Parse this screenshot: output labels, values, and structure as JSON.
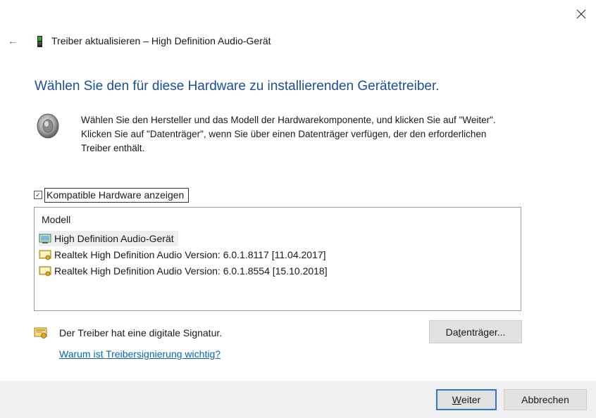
{
  "window": {
    "close_glyph": "✕",
    "back_glyph": "←",
    "title": "Treiber aktualisieren – High Definition Audio-Gerät"
  },
  "heading": "Wählen Sie den für diese Hardware zu installierenden Gerätetreiber.",
  "description": "Wählen Sie den Hersteller und das Modell der Hardwarekomponente, und klicken Sie auf \"Weiter\". Klicken Sie auf \"Datenträger\", wenn Sie über einen Datenträger verfügen, der den erforderlichen Treiber enthält.",
  "compatible": {
    "label": "Kompatible Hardware anzeigen",
    "checked": true,
    "check_glyph": "✓"
  },
  "list": {
    "header": "Modell",
    "items": [
      {
        "label": "High Definition Audio-Gerät",
        "icon": "audio-device-icon",
        "selected": true
      },
      {
        "label": "Realtek High Definition Audio Version: 6.0.1.8117 [11.04.2017]",
        "icon": "certified-driver-icon",
        "selected": false
      },
      {
        "label": "Realtek High Definition Audio Version: 6.0.1.8554 [15.10.2018]",
        "icon": "certified-driver-icon",
        "selected": false
      }
    ]
  },
  "signature": {
    "text": "Der Treiber hat eine digitale Signatur.",
    "link": "Warum ist Treibersignierung wichtig?",
    "icon": "certificate-icon"
  },
  "buttons": {
    "disk": {
      "pre": "Da",
      "access": "t",
      "post": "enträger..."
    },
    "next": {
      "access": "W",
      "post": "eiter"
    },
    "cancel": "Abbrechen"
  },
  "colors": {
    "heading": "#1c4fa0",
    "link": "#0a64b4",
    "default_button_border": "#3574c4",
    "footer_bg": "#f0f0f0"
  }
}
